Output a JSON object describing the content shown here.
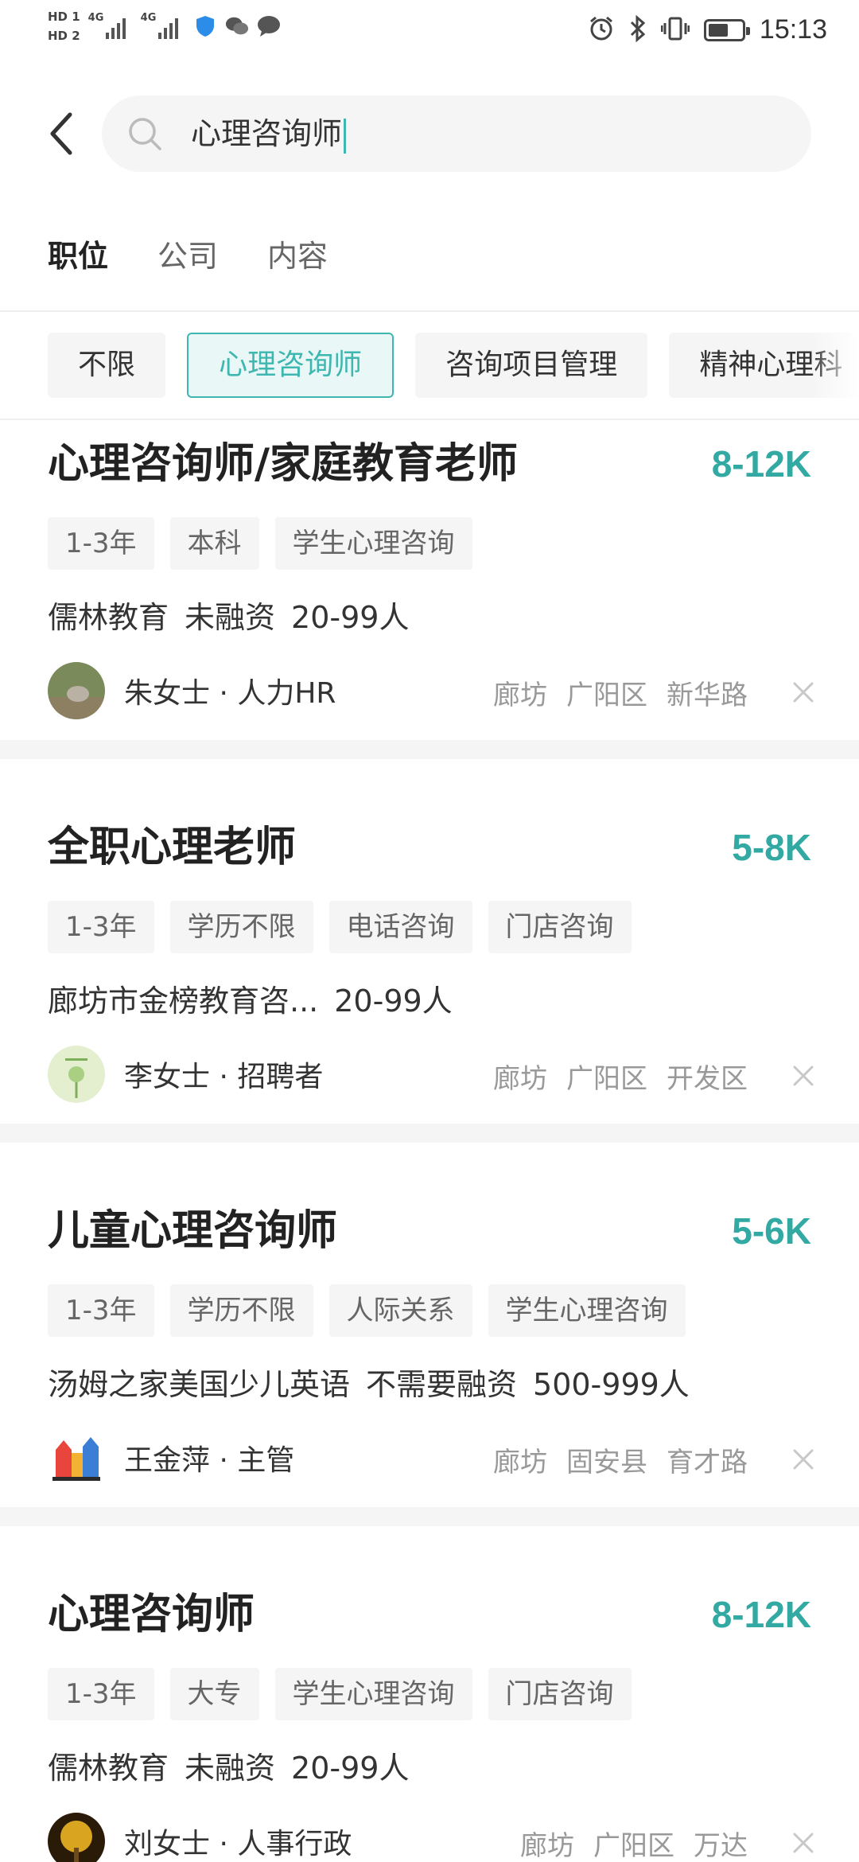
{
  "status_bar": {
    "hd1": "HD 1",
    "hd2": "HD 2",
    "net1": "4G",
    "net2": "4G",
    "time": "15:13",
    "battery_level": 0.6
  },
  "search": {
    "query": "心理咨询师"
  },
  "tabs": [
    {
      "label": "职位",
      "active": true
    },
    {
      "label": "公司",
      "active": false
    },
    {
      "label": "内容",
      "active": false
    }
  ],
  "filters": [
    {
      "label": "不限",
      "active": false
    },
    {
      "label": "心理咨询师",
      "active": true
    },
    {
      "label": "咨询项目管理",
      "active": false
    },
    {
      "label": "精神心理科",
      "active": false
    }
  ],
  "accent_color": "#3eb7b0",
  "jobs": [
    {
      "title": "心理咨询师/家庭教育老师",
      "salary": "8-12K",
      "tags": [
        "1-3年",
        "本科",
        "学生心理咨询"
      ],
      "company": [
        "儒林教育",
        "未融资",
        "20-99人"
      ],
      "recruiter": "朱女士 · 人力HR",
      "location": [
        "廊坊",
        "广阳区",
        "新华路"
      ]
    },
    {
      "title": "全职心理老师",
      "salary": "5-8K",
      "tags": [
        "1-3年",
        "学历不限",
        "电话咨询",
        "门店咨询"
      ],
      "company": [
        "廊坊市金榜教育咨...",
        "20-99人"
      ],
      "recruiter": "李女士 · 招聘者",
      "location": [
        "廊坊",
        "广阳区",
        "开发区"
      ]
    },
    {
      "title": "儿童心理咨询师",
      "salary": "5-6K",
      "tags": [
        "1-3年",
        "学历不限",
        "人际关系",
        "学生心理咨询"
      ],
      "company": [
        "汤姆之家美国少儿英语",
        "不需要融资",
        "500-999人"
      ],
      "recruiter": "王金萍 · 主管",
      "location": [
        "廊坊",
        "固安县",
        "育才路"
      ]
    },
    {
      "title": "心理咨询师",
      "salary": "8-12K",
      "tags": [
        "1-3年",
        "大专",
        "学生心理咨询",
        "门店咨询"
      ],
      "company": [
        "儒林教育",
        "未融资",
        "20-99人"
      ],
      "recruiter": "刘女士 · 人事行政",
      "location": [
        "廊坊",
        "广阳区",
        "万达"
      ]
    }
  ]
}
